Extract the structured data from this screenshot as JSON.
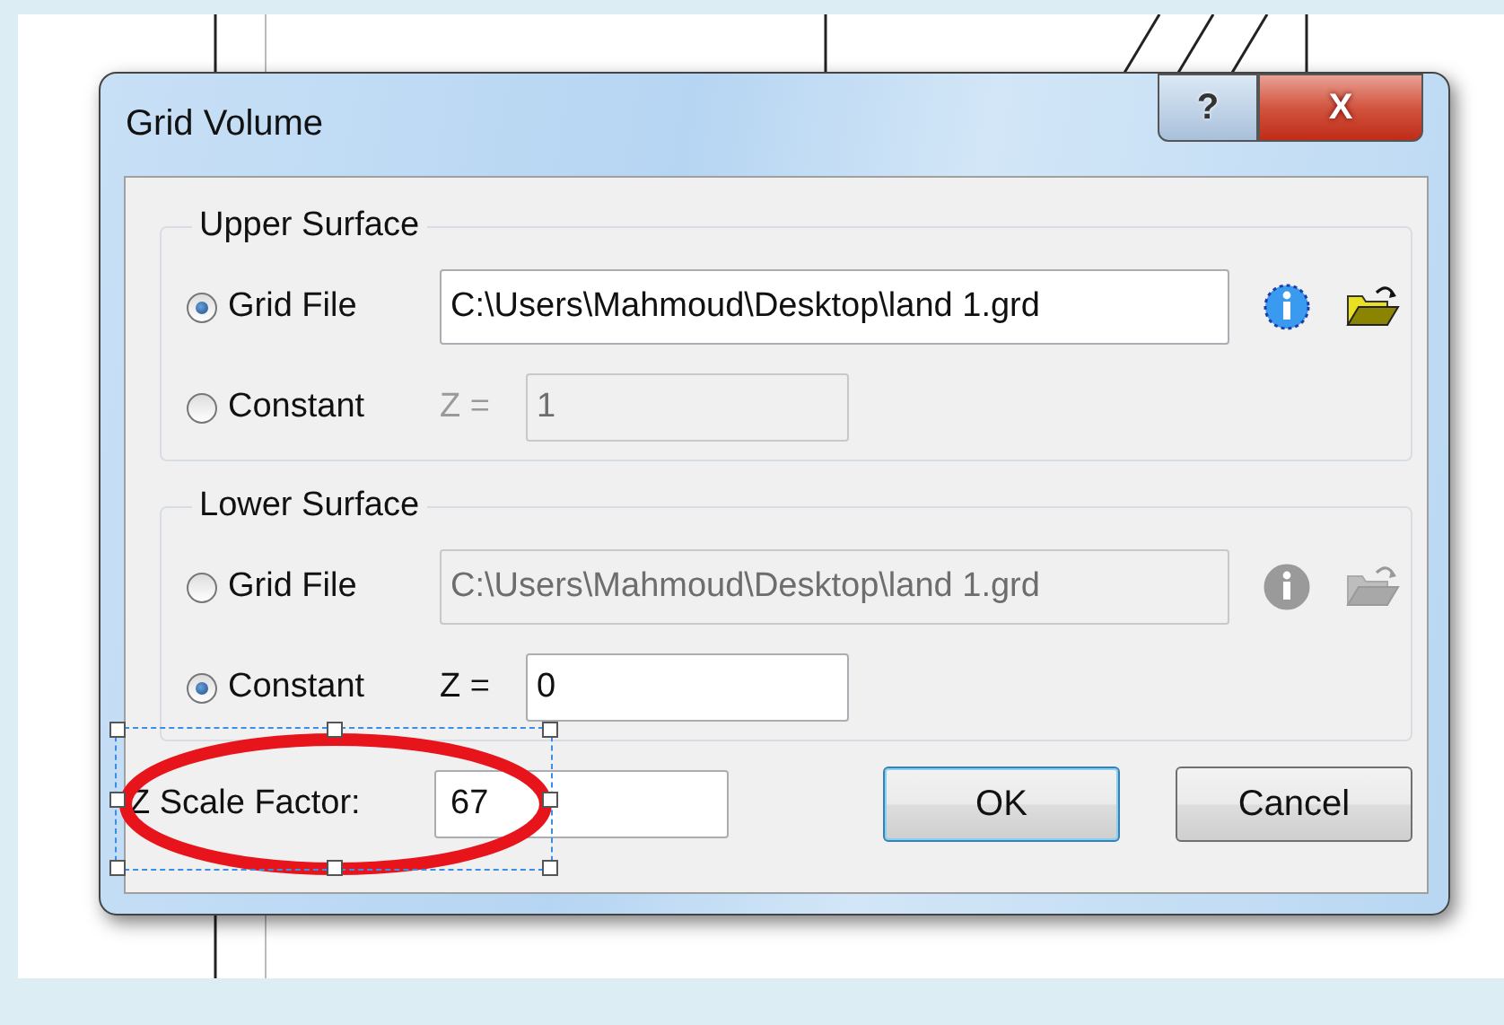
{
  "window": {
    "title": "Grid Volume",
    "buttons": [
      {
        "kind": "help",
        "label": "?"
      },
      {
        "kind": "close",
        "label": "X"
      }
    ]
  },
  "groups": [
    {
      "title": "Upper Surface",
      "options": [
        {
          "kind": "file",
          "label": "Grid File",
          "selected": true,
          "disabled": false,
          "value": "C:\\Users\\Mahmoud\\Desktop\\land 1.grd"
        },
        {
          "kind": "constant",
          "label": "Constant",
          "selected": false,
          "disabled": true,
          "z_label": "Z =",
          "value": "1"
        }
      ]
    },
    {
      "title": "Lower Surface",
      "options": [
        {
          "kind": "file",
          "label": "Grid File",
          "selected": false,
          "disabled": true,
          "value": "C:\\Users\\Mahmoud\\Desktop\\land 1.grd"
        },
        {
          "kind": "constant",
          "label": "Constant",
          "selected": true,
          "disabled": false,
          "z_label": "Z =",
          "value": "0"
        }
      ]
    }
  ],
  "scale": {
    "label": "Z Scale Factor:",
    "value": "67"
  },
  "buttons": [
    "OK",
    "Cancel"
  ]
}
